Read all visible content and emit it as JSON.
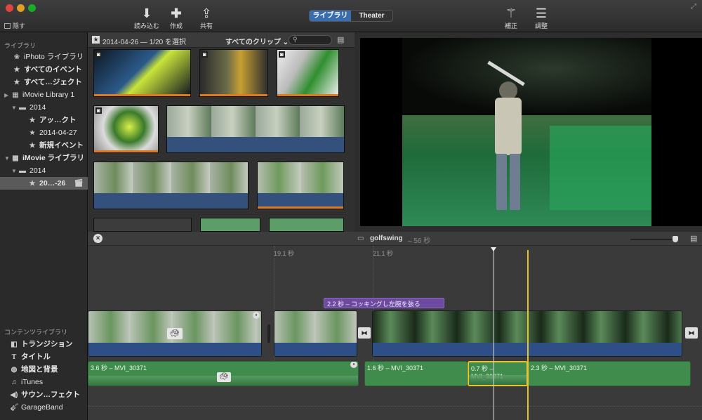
{
  "toolbar": {
    "hide_label": "隠す",
    "import_label": "読み込む",
    "create_label": "作成",
    "share_label": "共有",
    "tab_library": "ライブラリ",
    "tab_theater": "Theater",
    "enhance_label": "補正",
    "adjust_label": "調整"
  },
  "sidebar": {
    "libraries_header": "ライブラリ",
    "items": [
      {
        "label": "iPhoto ライブラリ"
      },
      {
        "label": "すべてのイベント"
      },
      {
        "label": "すべて…ジェクト"
      },
      {
        "label": "iMovie Library 1"
      },
      {
        "label": "2014"
      },
      {
        "label": "アッ…クト"
      },
      {
        "label": "2014-04-27"
      },
      {
        "label": "新規イベント"
      },
      {
        "label": "iMovie ライブラリ"
      },
      {
        "label": "2014"
      },
      {
        "label": "20…-26"
      }
    ],
    "content_header": "コンテンツライブラリ",
    "content_items": [
      {
        "label": "トランジション"
      },
      {
        "label": "タイトル"
      },
      {
        "label": "地図と背景"
      },
      {
        "label": "iTunes"
      },
      {
        "label": "サウン…フェクト"
      },
      {
        "label": "GarageBand"
      }
    ]
  },
  "browser": {
    "selection_info": "2014-04-26 — 1/20 を選択",
    "filter": "すべてのクリップ ⌄",
    "search_placeholder": ""
  },
  "timeline": {
    "project_name": "golfswing",
    "duration": "– 56 秒",
    "ruler_marks": [
      "19.1 秒",
      "21.1 秒"
    ],
    "title_clip": "2.2 秒 –   コッキングし左腕を張る",
    "audio_clips": [
      {
        "label": "3.6 秒 – MVI_30371"
      },
      {
        "label": "1.6 秒 – MVI_30371"
      },
      {
        "label": "0.7 秒 – MVI_30371"
      },
      {
        "label": "2.3 秒 – MVI_30371"
      }
    ]
  },
  "colors": {
    "accent": "#3a6db0",
    "selection_yellow": "#e8c230",
    "title_purple": "#6c4aa0",
    "audio_green": "#3f8c4c"
  }
}
